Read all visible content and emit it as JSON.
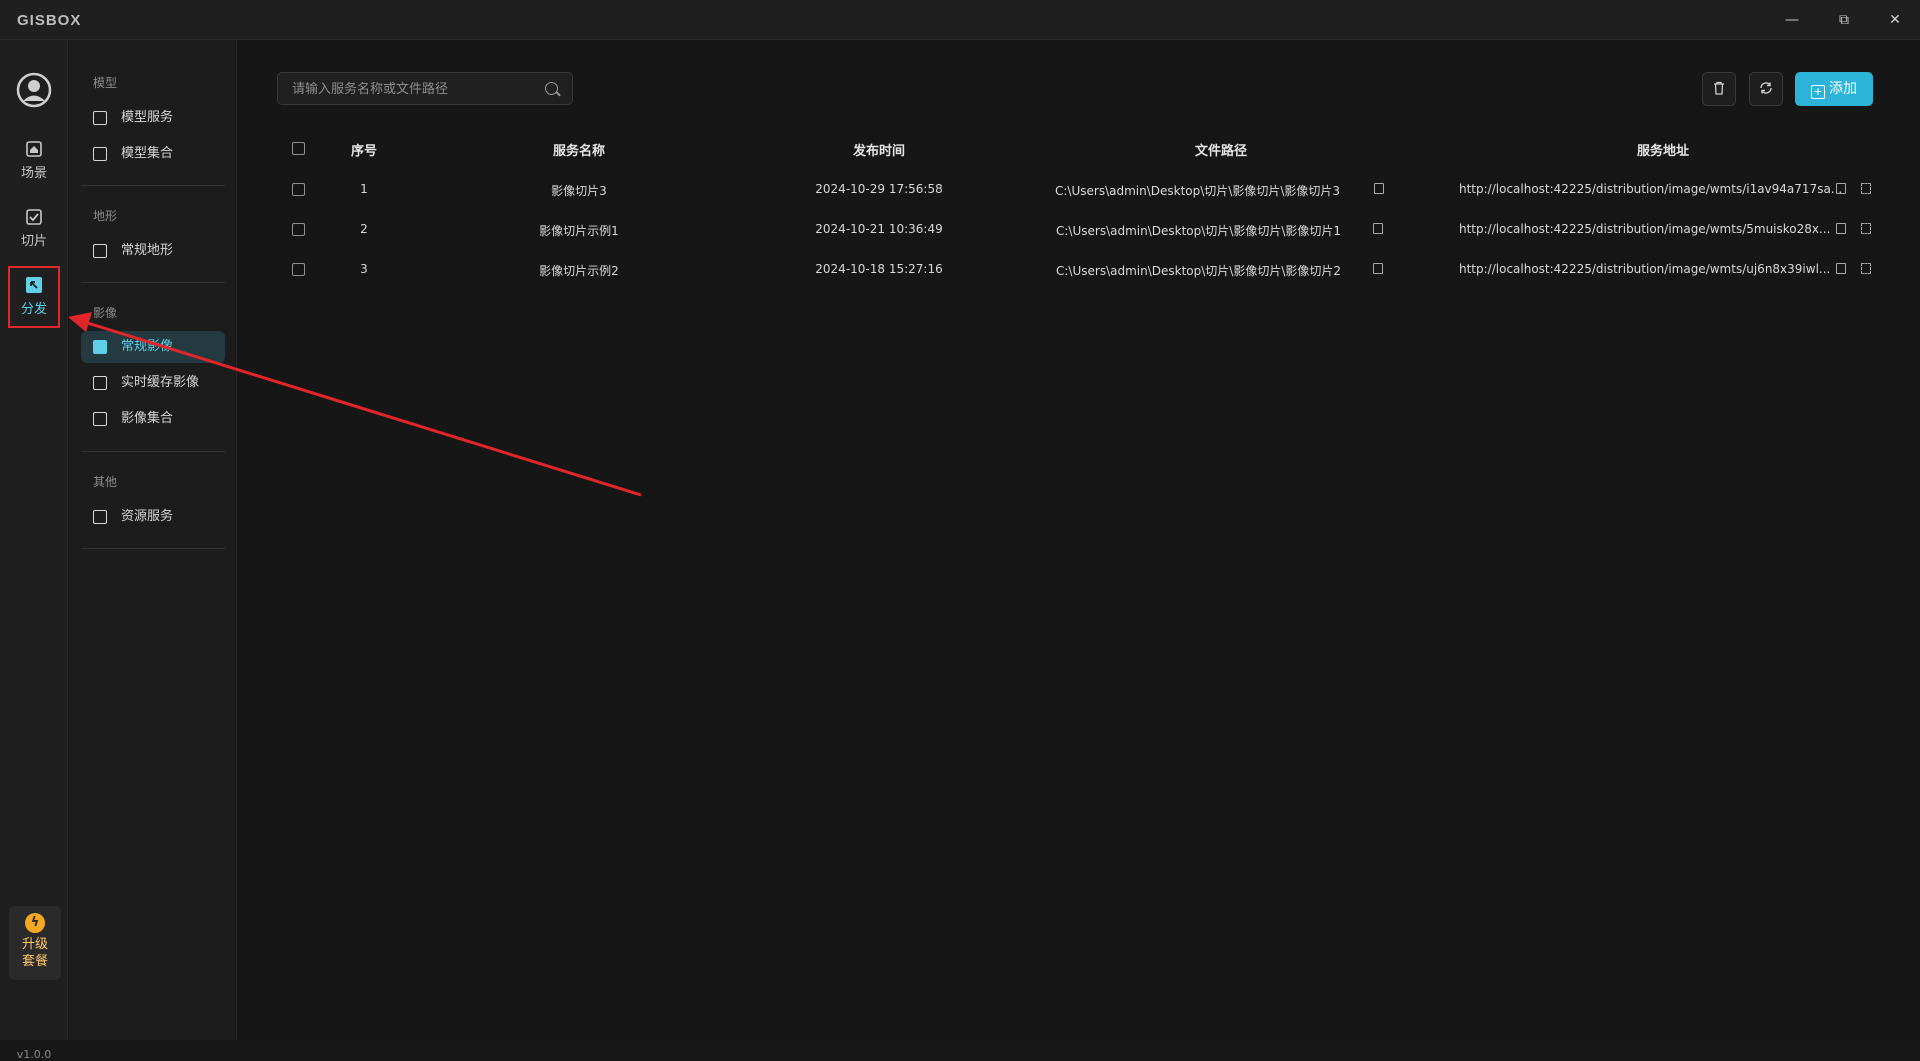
{
  "app": {
    "logo": "GISBOX"
  },
  "window": {
    "minimize": "—",
    "maximize": "⧉",
    "close": "✕"
  },
  "rail": {
    "items": [
      {
        "label": "场景",
        "icon": "home-icon"
      },
      {
        "label": "切片",
        "icon": "slice-icon"
      },
      {
        "label": "分发",
        "icon": "distribute-icon",
        "active": true
      }
    ],
    "upgrade": {
      "line1": "升级",
      "line2": "套餐"
    },
    "version": "v1.0.0"
  },
  "sidebar": {
    "groups": [
      {
        "title": "模型",
        "items": [
          "模型服务",
          "模型集合"
        ]
      },
      {
        "title": "地形",
        "items": [
          "常规地形"
        ]
      },
      {
        "title": "影像",
        "items": [
          "常规影像",
          "实时缓存影像",
          "影像集合"
        ]
      },
      {
        "title": "其他",
        "items": [
          "资源服务"
        ]
      }
    ]
  },
  "toolbar": {
    "search_placeholder": "请输入服务名称或文件路径",
    "add_label": "添加"
  },
  "table": {
    "headers": [
      "序号",
      "服务名称",
      "发布时间",
      "文件路径",
      "服务地址"
    ],
    "rows": [
      {
        "index": "1",
        "name": "影像切片3",
        "time": "2024-10-29 17:56:58",
        "path": "C:\\Users\\admin\\Desktop\\切片\\影像切片\\影像切片3",
        "url": "http://localhost:42225/distribution/image/wmts/i1av94a717sa..."
      },
      {
        "index": "2",
        "name": "影像切片示例1",
        "time": "2024-10-21 10:36:49",
        "path": "C:\\Users\\admin\\Desktop\\切片\\影像切片\\影像切片1",
        "url": "http://localhost:42225/distribution/image/wmts/5muisko28x..."
      },
      {
        "index": "3",
        "name": "影像切片示例2",
        "time": "2024-10-18 15:27:16",
        "path": "C:\\Users\\admin\\Desktop\\切片\\影像切片\\影像切片2",
        "url": "http://localhost:42225/distribution/image/wmts/uj6n8x39iwl..."
      }
    ]
  },
  "colors": {
    "accent": "#2bb3d8",
    "active_text": "#5fd0e8",
    "annotation": "#e0262b"
  }
}
